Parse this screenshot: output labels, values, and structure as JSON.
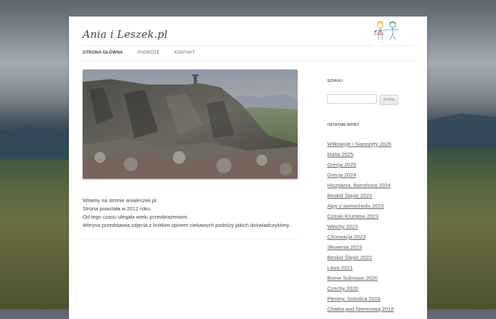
{
  "site": {
    "title": "Ania i Leszek.pl"
  },
  "nav": {
    "items": [
      {
        "label": "STRONA GŁÓWNA",
        "current": true
      },
      {
        "label": "PODRÓŻE",
        "current": false
      },
      {
        "label": "KONTAKT",
        "current": false
      }
    ]
  },
  "intro": {
    "lines": [
      "Witamy na stronie anialeszek.pl",
      "Strona powstała w 2012 roku.",
      "Od tego czasu ulegała wielu przeobrażeniom.",
      "Witryna przedstawia zdjęcia z krótkim opisem ciekawych podróży jakich doświadczyliśmy."
    ]
  },
  "sidebar": {
    "search_title": "SZUKAJ",
    "search_value": "",
    "search_button": "Szukaj",
    "recent_title": "OSTATNIE WPISY",
    "recent_posts": [
      "Wilkowyje i Sianożęty 2026",
      "Malta 2025",
      "Grecja 2025",
      "Grecja 2024",
      "Hiszpania, Barcelona 2024",
      "Beskid Śląski 2023",
      "Alpy z samochodu 2023",
      "Czeski Krumlow 2023",
      "Włochy 2023",
      "Chorwacja 2023",
      "Słowenia 2023",
      "Beskid Śląski 2022",
      "Litwa 2021",
      "Borne Sulinowo 2020",
      "Czechy 2020",
      "Pieniny, Sokolica 2018",
      "Chatka pod Niemcową 2018"
    ]
  },
  "colors": {
    "link": "#5e5e5e",
    "text": "#444444",
    "border": "#ededed"
  }
}
